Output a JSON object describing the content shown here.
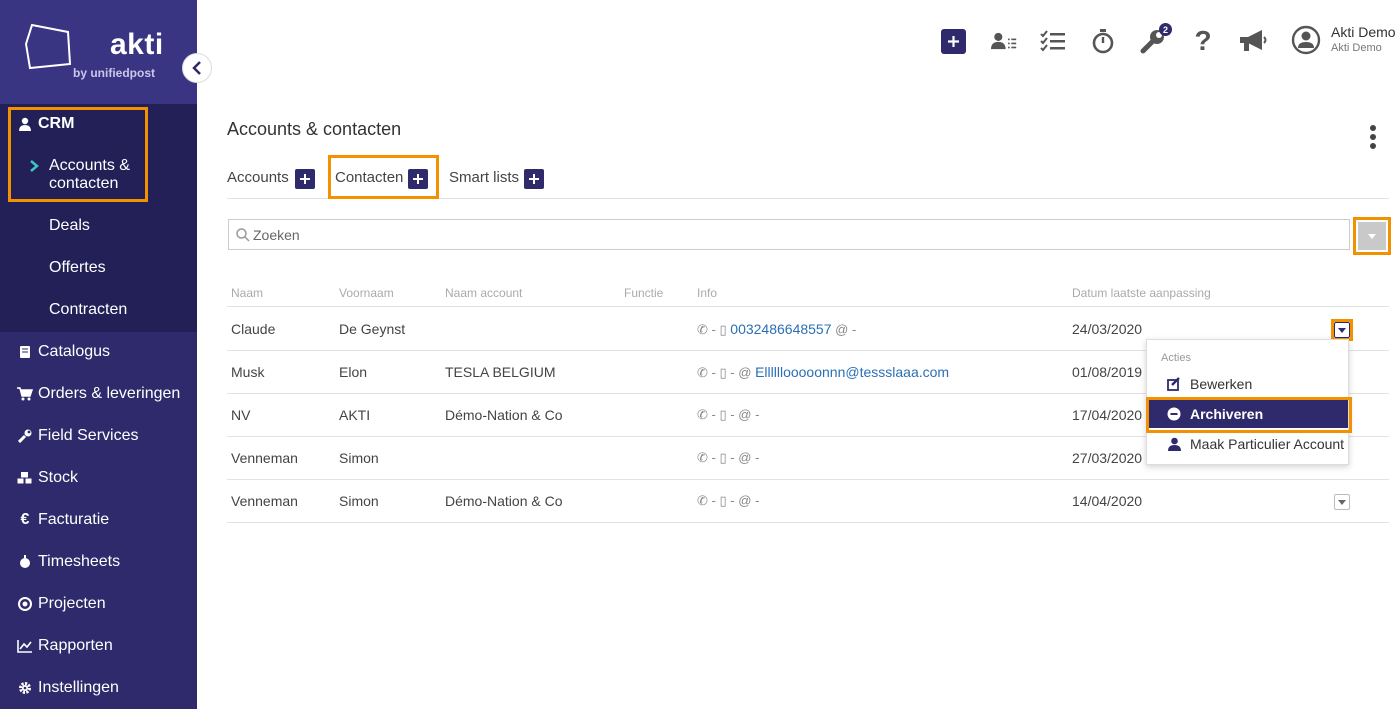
{
  "brand": {
    "name": "akti",
    "sub": "by unifiedpost"
  },
  "sidebar": {
    "crm_label": "CRM",
    "crm_items": [
      {
        "label": "Accounts &\ncontacten"
      },
      {
        "label": "Deals"
      },
      {
        "label": "Offertes"
      },
      {
        "label": "Contracten"
      }
    ],
    "items": [
      {
        "label": "Catalogus",
        "icon": "book-icon"
      },
      {
        "label": "Orders & leveringen",
        "icon": "cart-icon"
      },
      {
        "label": "Field Services",
        "icon": "wrench-icon"
      },
      {
        "label": "Stock",
        "icon": "boxes-icon"
      },
      {
        "label": "Facturatie",
        "icon": "euro-icon"
      },
      {
        "label": "Timesheets",
        "icon": "stopwatch-icon"
      },
      {
        "label": "Projecten",
        "icon": "target-icon"
      },
      {
        "label": "Rapporten",
        "icon": "chart-icon"
      },
      {
        "label": "Instellingen",
        "icon": "gear-icon"
      }
    ]
  },
  "topbar": {
    "badge_count": "2",
    "user_name": "Akti Demo",
    "user_company": "Akti Demo"
  },
  "main": {
    "title": "Accounts & contacten",
    "tabs": [
      {
        "label": "Accounts"
      },
      {
        "label": "Contacten"
      },
      {
        "label": "Smart lists"
      }
    ],
    "search_placeholder": "Zoeken",
    "columns": [
      "Naam",
      "Voornaam",
      "Naam account",
      "Functie",
      "Info",
      "Datum laatste aanpassing"
    ],
    "rows": [
      {
        "naam": "Claude",
        "voornaam": "De Geynst",
        "account": "",
        "functie": "",
        "phone": "0032486648557",
        "email": "",
        "datum": "24/03/2020"
      },
      {
        "naam": "Musk",
        "voornaam": "Elon",
        "account": "TESLA BELGIUM",
        "functie": "",
        "phone": "",
        "email": "Ellllllooooonnn@tessslaaa.com",
        "datum": "01/08/2019"
      },
      {
        "naam": "NV",
        "voornaam": "AKTI",
        "account": "Démo-Nation & Co",
        "functie": "",
        "phone": "",
        "email": "",
        "datum": "17/04/2020"
      },
      {
        "naam": "Venneman",
        "voornaam": "Simon",
        "account": "",
        "functie": "",
        "phone": "",
        "email": "",
        "datum": "27/03/2020"
      },
      {
        "naam": "Venneman",
        "voornaam": "Simon",
        "account": "Démo-Nation & Co",
        "functie": "",
        "phone": "",
        "email": "",
        "datum": "14/04/2020"
      }
    ],
    "info_sep_phone": "-",
    "info_sep_mobile": "-",
    "info_at": "@",
    "info_dash": "-"
  },
  "menu": {
    "heading": "Acties",
    "items": [
      {
        "label": "Bewerken"
      },
      {
        "label": "Archiveren"
      },
      {
        "label": "Maak Particulier Account"
      }
    ]
  },
  "colors": {
    "brand": "#2e2a6b",
    "highlight": "#f39200",
    "link": "#2a6fb5"
  }
}
